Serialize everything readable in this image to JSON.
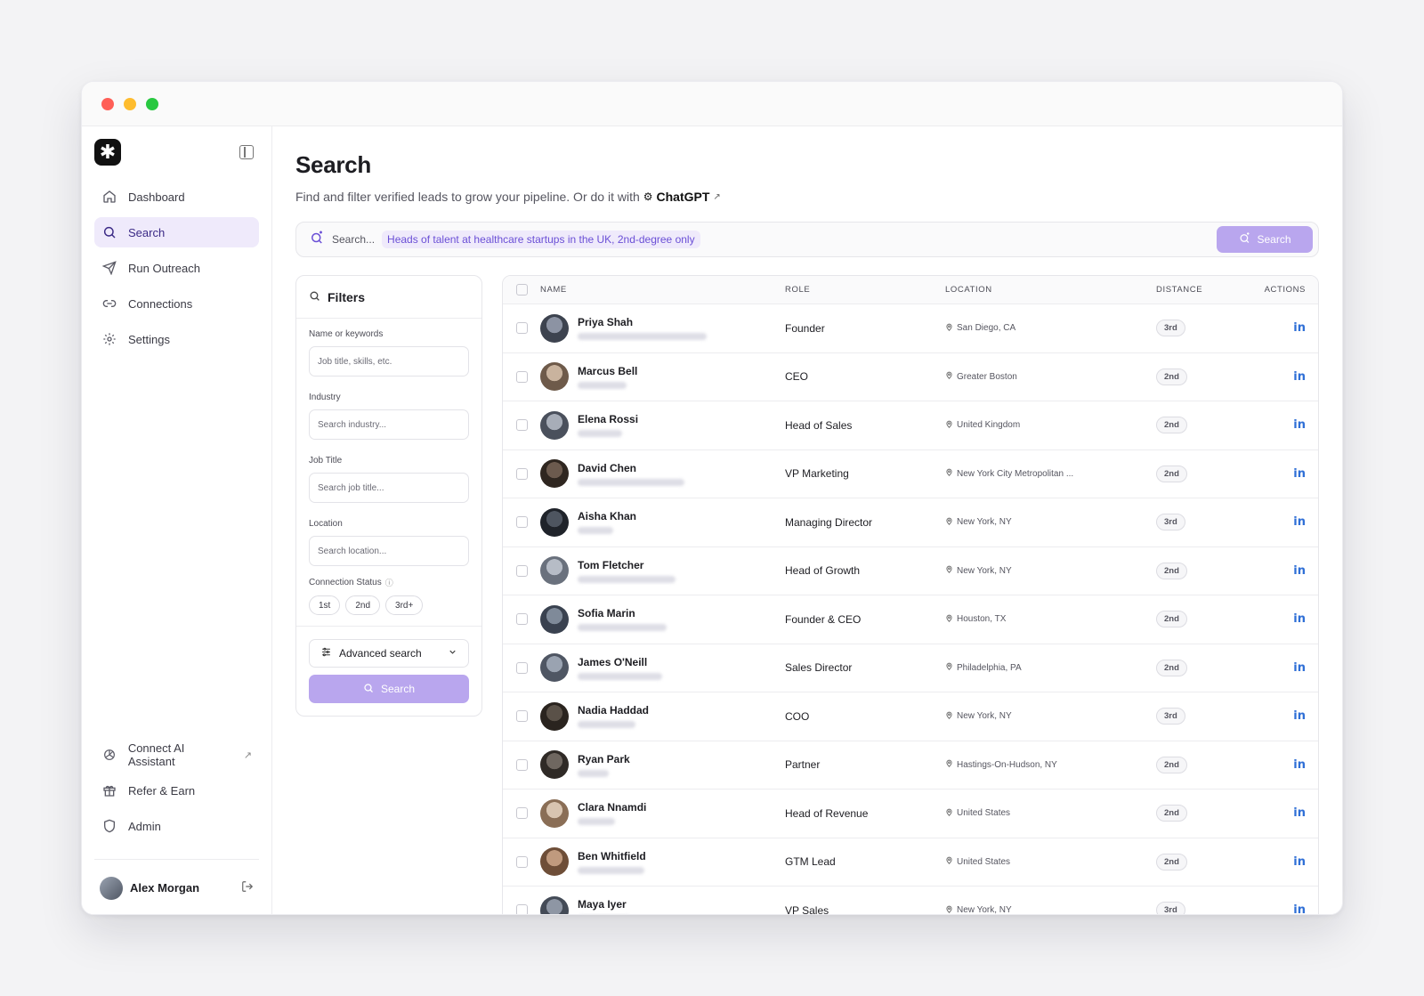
{
  "sidebar": {
    "nav": [
      {
        "label": "Dashboard",
        "icon": "home-icon",
        "active": false
      },
      {
        "label": "Search",
        "icon": "search-icon",
        "active": true
      },
      {
        "label": "Run Outreach",
        "icon": "send-icon",
        "active": false
      },
      {
        "label": "Connections",
        "icon": "link-icon",
        "active": false
      },
      {
        "label": "Settings",
        "icon": "gear-icon",
        "active": false
      }
    ],
    "bottom": [
      {
        "label": "Connect AI Assistant",
        "icon": "openai-icon"
      },
      {
        "label": "Refer & Earn",
        "icon": "gift-icon"
      },
      {
        "label": "Admin",
        "icon": "shield-icon"
      }
    ],
    "user": {
      "name": "Alex Morgan"
    }
  },
  "page": {
    "title": "Search",
    "subtitle": "Find and filter verified leads to grow your pipeline. Or do it with",
    "subtitle_link": "ChatGPT"
  },
  "searchbar": {
    "placeholder": "Search...",
    "suggestion": "Heads of talent at healthcare startups in the UK, 2nd-degree only",
    "button": "Search"
  },
  "filters": {
    "title": "Filters",
    "fields": [
      {
        "label": "Name or keywords",
        "placeholder": "Job title, skills, etc."
      },
      {
        "label": "Industry",
        "placeholder": "Search industry..."
      },
      {
        "label": "Job Title",
        "placeholder": "Search job title..."
      },
      {
        "label": "Location",
        "placeholder": "Search location..."
      }
    ],
    "connection_status_label": "Connection Status",
    "connection_options": [
      "1st",
      "2nd",
      "3rd+"
    ],
    "advanced_label": "Advanced search",
    "search_button": "Search"
  },
  "table": {
    "columns": {
      "name": "NAME",
      "role": "ROLE",
      "location": "LOCATION",
      "distance": "DISTANCE",
      "actions": "ACTIONS"
    },
    "rows": [
      {
        "name": "Priya Shah",
        "role": "Founder",
        "location": "San Diego, CA",
        "distance": "3rd"
      },
      {
        "name": "Marcus Bell",
        "role": "CEO",
        "location": "Greater Boston",
        "distance": "2nd"
      },
      {
        "name": "Elena Rossi",
        "role": "Head of Sales",
        "location": "United Kingdom",
        "distance": "2nd"
      },
      {
        "name": "David Chen",
        "role": "VP Marketing",
        "location": "New York City Metropolitan ...",
        "distance": "2nd"
      },
      {
        "name": "Aisha Khan",
        "role": "Managing Director",
        "location": "New York, NY",
        "distance": "3rd"
      },
      {
        "name": "Tom Fletcher",
        "role": "Head of Growth",
        "location": "New York, NY",
        "distance": "2nd"
      },
      {
        "name": "Sofia Marin",
        "role": "Founder & CEO",
        "location": "Houston, TX",
        "distance": "2nd"
      },
      {
        "name": "James O'Neill",
        "role": "Sales Director",
        "location": "Philadelphia, PA",
        "distance": "2nd"
      },
      {
        "name": "Nadia Haddad",
        "role": "COO",
        "location": "New York, NY",
        "distance": "3rd"
      },
      {
        "name": "Ryan Park",
        "role": "Partner",
        "location": "Hastings-On-Hudson, NY",
        "distance": "2nd"
      },
      {
        "name": "Clara Nnamdi",
        "role": "Head of Revenue",
        "location": "United States",
        "distance": "2nd"
      },
      {
        "name": "Ben Whitfield",
        "role": "GTM Lead",
        "location": "United States",
        "distance": "2nd"
      },
      {
        "name": "Maya Iyer",
        "role": "VP Sales",
        "location": "New York, NY",
        "distance": "3rd"
      }
    ]
  },
  "colors": {
    "accent": "#b9a6ee",
    "accent_dark": "#6a4fd6",
    "active_bg": "#efeafb",
    "linkedin": "#2f6fd6"
  }
}
